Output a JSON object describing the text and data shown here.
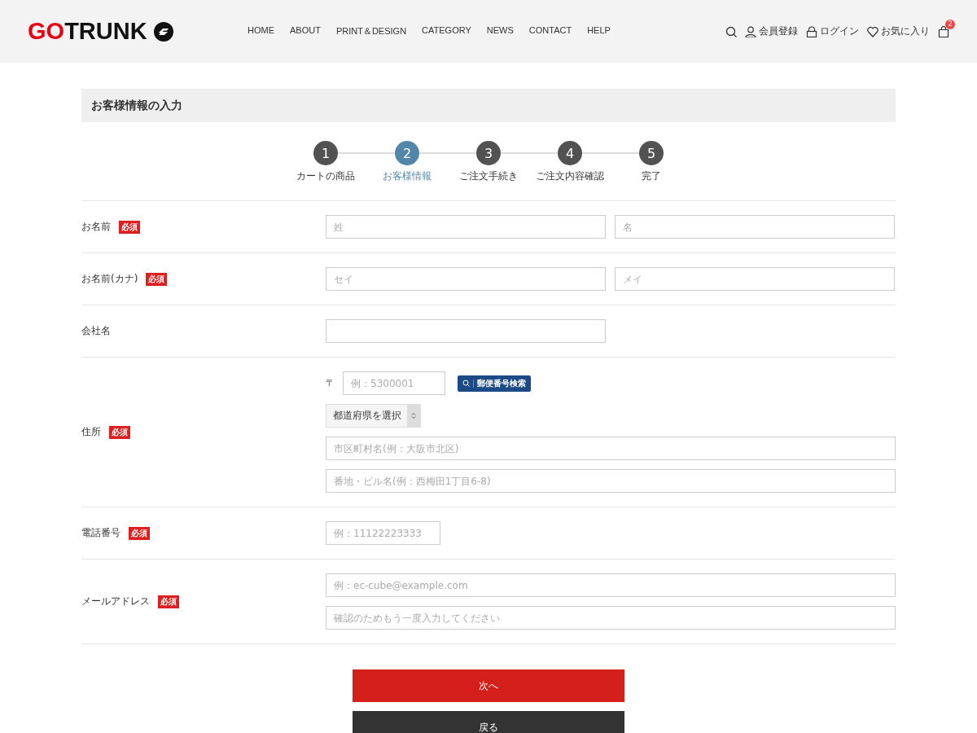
{
  "header": {
    "logo": {
      "part_1": "GO",
      "part_2": "TRUNK"
    },
    "nav": [
      "HOME",
      "ABOUT",
      "PRINT＆DESIGN",
      "CATEGORY",
      "NEWS",
      "CONTACT",
      "HELP"
    ],
    "utilities": [
      {
        "kind": "search"
      },
      {
        "kind": "user",
        "label": "会員登録"
      },
      {
        "kind": "lock",
        "label": "ログイン"
      },
      {
        "kind": "heart",
        "label": "お気に入り"
      },
      {
        "kind": "cart",
        "count": "2"
      }
    ]
  },
  "page_title": "お客様情報の入力",
  "steps": [
    {
      "number": "1",
      "label": "カートの商品",
      "selected": false
    },
    {
      "number": "2",
      "label": "お客様情報",
      "selected": true
    },
    {
      "number": "3",
      "label": "ご注文手続き",
      "selected": false
    },
    {
      "number": "4",
      "label": "ご注文内容確認",
      "selected": false
    },
    {
      "number": "5",
      "label": "完了",
      "selected": false
    }
  ],
  "form": [
    {
      "label": "お名前",
      "badge": "必須",
      "lines": [
        [
          {
            "kind": "half",
            "placeholder": "姓"
          },
          {
            "kind": "half",
            "placeholder": "名"
          }
        ]
      ]
    },
    {
      "label": "お名前(カナ)",
      "badge": "必須",
      "lines": [
        [
          {
            "kind": "half",
            "placeholder": "セイ"
          },
          {
            "kind": "half",
            "placeholder": "メイ"
          }
        ]
      ]
    },
    {
      "label": "会社名",
      "lines": [
        [
          {
            "kind": "half"
          }
        ]
      ]
    },
    {
      "label": "住所",
      "badge": "必須",
      "lines": [
        [
          {
            "kind": "mark",
            "text": "〒"
          },
          {
            "kind": "short",
            "placeholder": "例：5300001"
          },
          {
            "kind": "search_button",
            "text": "郵便番号検索"
          }
        ],
        [
          {
            "kind": "select",
            "value": "都道府県を選択"
          }
        ],
        [
          {
            "kind": "full",
            "placeholder": "市区町村名(例：大阪市北区)"
          }
        ],
        [
          {
            "kind": "full",
            "placeholder": "番地・ビル名(例：西梅田1丁目6-8)"
          }
        ]
      ]
    },
    {
      "label": "電話番号",
      "badge": "必須",
      "lines": [
        [
          {
            "kind": "short",
            "placeholder": "例：11122223333"
          }
        ]
      ]
    },
    {
      "label": "メールアドレス",
      "badge": "必須",
      "lines": [
        [
          {
            "kind": "full",
            "placeholder": "例：ec-cube@example.com"
          }
        ],
        [
          {
            "kind": "full",
            "placeholder": "確認のためもう一度入力してください"
          }
        ]
      ]
    }
  ],
  "buttons": [
    {
      "kind": "primary",
      "label": "次へ"
    },
    {
      "kind": "secondary",
      "label": "戻る"
    }
  ]
}
